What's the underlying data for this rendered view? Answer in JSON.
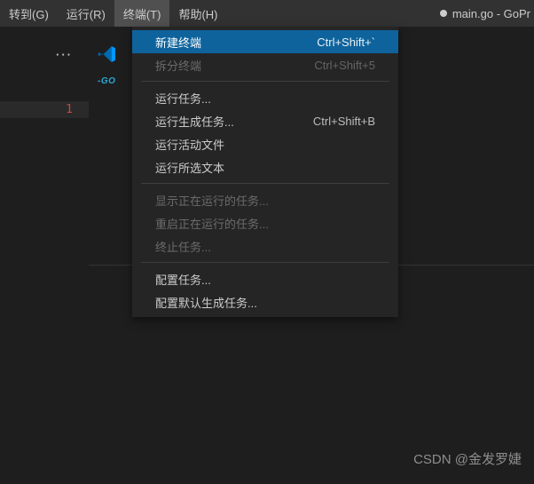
{
  "menubar": {
    "items": [
      {
        "label": "转到(G)"
      },
      {
        "label": "运行(R)"
      },
      {
        "label": "终端(T)"
      },
      {
        "label": "帮助(H)"
      }
    ],
    "active_index": 2,
    "title": "main.go - GoPr"
  },
  "gutter": {
    "ellipsis": "···",
    "line_number": "1"
  },
  "go_badge": "-GO",
  "dropdown": {
    "groups": [
      [
        {
          "label": "新建终端",
          "shortcut": "Ctrl+Shift+`",
          "selected": true,
          "disabled": false
        },
        {
          "label": "拆分终端",
          "shortcut": "Ctrl+Shift+5",
          "selected": false,
          "disabled": true
        }
      ],
      [
        {
          "label": "运行任务...",
          "shortcut": "",
          "selected": false,
          "disabled": false
        },
        {
          "label": "运行生成任务...",
          "shortcut": "Ctrl+Shift+B",
          "selected": false,
          "disabled": false
        },
        {
          "label": "运行活动文件",
          "shortcut": "",
          "selected": false,
          "disabled": false
        },
        {
          "label": "运行所选文本",
          "shortcut": "",
          "selected": false,
          "disabled": false
        }
      ],
      [
        {
          "label": "显示正在运行的任务...",
          "shortcut": "",
          "selected": false,
          "disabled": true
        },
        {
          "label": "重启正在运行的任务...",
          "shortcut": "",
          "selected": false,
          "disabled": true
        },
        {
          "label": "终止任务...",
          "shortcut": "",
          "selected": false,
          "disabled": true
        }
      ],
      [
        {
          "label": "配置任务...",
          "shortcut": "",
          "selected": false,
          "disabled": false
        },
        {
          "label": "配置默认生成任务...",
          "shortcut": "",
          "selected": false,
          "disabled": false
        }
      ]
    ]
  },
  "watermark": "CSDN @金发罗婕"
}
